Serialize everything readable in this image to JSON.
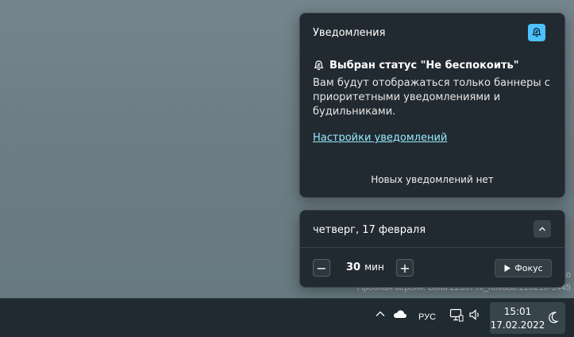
{
  "watermark": {
    "line1": "о",
    "line2": "Пробная версия. Build 22557.ni_release.220210-1445"
  },
  "notifications": {
    "header": "Уведомления",
    "dnd_toggle_icon": "bell-snooze-icon",
    "status_icon": "bell-snooze-icon",
    "status_title": "Выбран статус \"Не беспокоить\"",
    "status_description": "Вам будут отображаться только баннеры с приоритетными уведомлениями и будильниками.",
    "settings_link": "Настройки уведомлений",
    "empty_text": "Новых уведомлений нет",
    "accent_color": "#4cc2ff",
    "link_color": "#99ebff"
  },
  "calendar": {
    "date": "четверг, 17 февраля",
    "collapse_icon": "chevron-up-icon",
    "focus": {
      "minus_label": "−",
      "value": "30",
      "unit": "мин",
      "plus_label": "+",
      "button_label": "Фокус",
      "button_icon": "play-icon"
    }
  },
  "taskbar": {
    "tray_icons": [
      "chevron-up-icon",
      "cloud-icon"
    ],
    "language": "РУС",
    "status_icons": [
      "network-icon",
      "volume-icon"
    ],
    "time": "15:01",
    "date": "17.02.2022",
    "moon_icon": "moon-icon"
  }
}
